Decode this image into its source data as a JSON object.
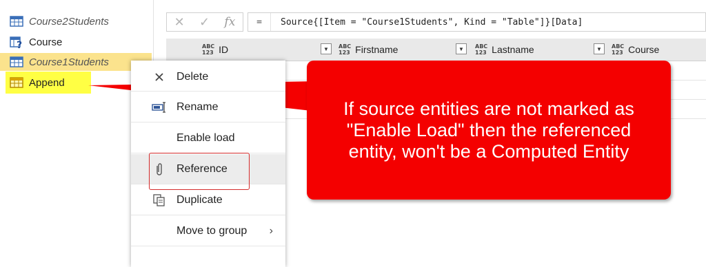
{
  "queries": {
    "items": [
      {
        "label": "Course2Students",
        "icon": "table-icon",
        "style": "italic"
      },
      {
        "label": "Course",
        "icon": "table-unknown-icon",
        "style": "normal"
      },
      {
        "label": "Course1Students",
        "icon": "table-icon",
        "style": "italic-selected"
      },
      {
        "label": "Append",
        "icon": "table-icon",
        "style": "highlighted"
      }
    ]
  },
  "formula_bar": {
    "cancel_icon": "✕",
    "confirm_icon": "✓",
    "fx_label": "fx",
    "eq": "=",
    "formula": "Source{[Item = \"Course1Students\", Kind = \"Table\"]}[Data]"
  },
  "grid": {
    "type_badge_top": "ABC",
    "type_badge_bottom": "123",
    "columns": [
      "ID",
      "Firstname",
      "Lastname",
      "Course"
    ]
  },
  "context_menu": {
    "items": [
      {
        "label": "Delete",
        "icon": "delete-x-icon"
      },
      {
        "label": "Rename",
        "icon": "rename-icon"
      },
      {
        "label": "Enable load",
        "icon": ""
      },
      {
        "label": "Reference",
        "icon": "paperclip-icon"
      },
      {
        "label": "Duplicate",
        "icon": "duplicate-icon"
      },
      {
        "label": "Move to group",
        "icon": "chevron-right-icon"
      }
    ],
    "chevron": "›"
  },
  "callout": {
    "text": "If source entities are not marked as \"Enable Load\" then the referenced entity, won't be a Computed Entity",
    "color": "#f40000"
  },
  "colors": {
    "append_highlight": "#ffff44",
    "selected_row": "#fbe38d",
    "reference_box": "#d42a2a"
  }
}
